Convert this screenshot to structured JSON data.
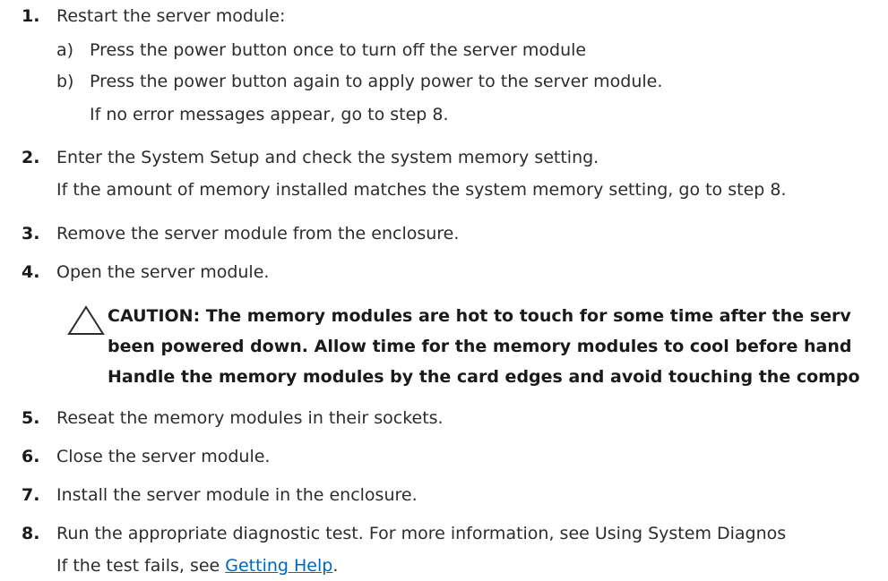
{
  "steps": [
    {
      "number": "1.",
      "text": "Restart the server module:",
      "substeps": [
        {
          "letter": "a)",
          "text": "Press the power button once to turn off the server module"
        },
        {
          "letter": "b)",
          "text": "Press the power button again to apply power to the server module."
        }
      ],
      "note": "If no error messages appear, go to step 8."
    },
    {
      "number": "2.",
      "text": "Enter the System Setup and check the system memory setting.",
      "note": "If the amount of memory installed matches the system memory setting, go to step 8."
    },
    {
      "number": "3.",
      "text": "Remove the server module from the enclosure."
    },
    {
      "number": "4.",
      "text": "Open the server module.",
      "caution": [
        "CAUTION: The memory modules are hot to touch for some time after the serv",
        "been powered down. Allow time for the memory modules to cool before hand",
        "Handle the memory modules by the card edges and avoid touching the compo"
      ]
    },
    {
      "number": "5.",
      "text": "Reseat the memory modules in their sockets."
    },
    {
      "number": "6.",
      "text": "Close the server module."
    },
    {
      "number": "7.",
      "text": "Install the server module in the enclosure."
    },
    {
      "number": "8.",
      "text": "Run the appropriate diagnostic test. For more information, see Using System Diagnos",
      "note_prefix": "If the test fails, see ",
      "link": "Getting Help",
      "note_suffix": "."
    }
  ],
  "icons": {
    "caution": "warning-triangle-icon"
  }
}
